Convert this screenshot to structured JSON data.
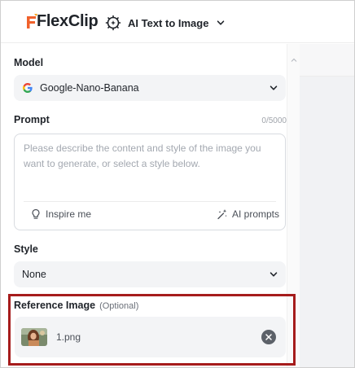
{
  "header": {
    "brand": "FlexClip",
    "tool_label": "AI Text to Image"
  },
  "panel": {
    "model_label": "Model",
    "model_value": "Google-Nano-Banana",
    "prompt_label": "Prompt",
    "prompt_counter": "0/5000",
    "prompt_placeholder": "Please describe the content and style of the image you want to generate, or select a style below.",
    "inspire_label": "Inspire me",
    "ai_prompts_label": "AI prompts",
    "style_label": "Style",
    "style_value": "None",
    "reference_label": "Reference Image",
    "reference_optional": "(Optional)",
    "reference_file": "1.png"
  },
  "colors": {
    "brand_orange": "#f0612b",
    "highlight_border": "#a61c1c",
    "select_bg": "#f3f4f6"
  },
  "icons": {
    "tool": "ai-sparkle-gear-icon",
    "model": "google-g-icon",
    "inspire": "lightbulb-icon",
    "ai_prompts": "magic-wand-icon",
    "remove": "close-circle-icon"
  }
}
